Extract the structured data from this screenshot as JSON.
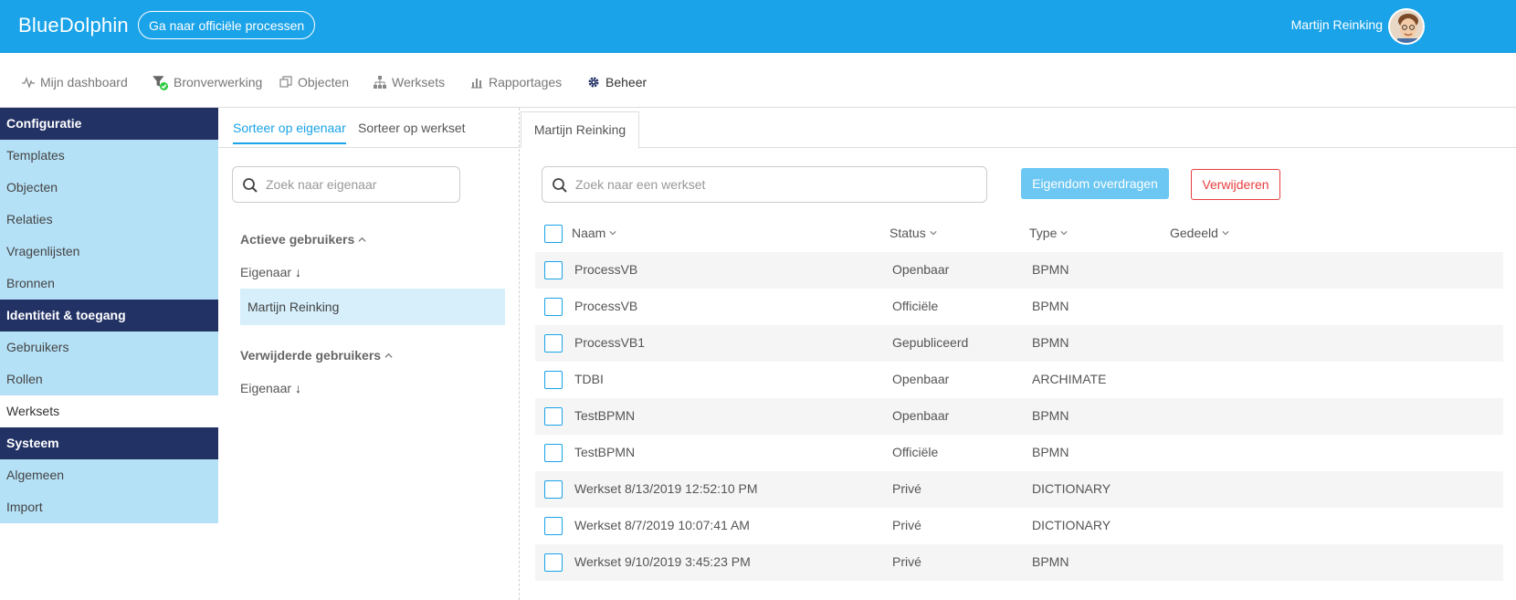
{
  "header": {
    "brand": "BlueDolphin",
    "official_button": "Ga naar officiële processen",
    "user_name": "Martijn Reinking"
  },
  "nav": [
    {
      "label": "Mijn dashboard",
      "icon": "pulse-icon"
    },
    {
      "label": "Bronverwerking",
      "icon": "funnel-check-icon"
    },
    {
      "label": "Objecten",
      "icon": "objects-icon"
    },
    {
      "label": "Werksets",
      "icon": "hierarchy-icon"
    },
    {
      "label": "Rapportages",
      "icon": "bar-chart-icon"
    },
    {
      "label": "Beheer",
      "icon": "gear-icon"
    }
  ],
  "sidebar": {
    "sections": [
      {
        "title": "Configuratie",
        "items": [
          "Templates",
          "Objecten",
          "Relaties",
          "Vragenlijsten",
          "Bronnen"
        ]
      },
      {
        "title": "Identiteit & toegang",
        "items": [
          "Gebruikers",
          "Rollen",
          "Werksets"
        ]
      },
      {
        "title": "Systeem",
        "items": [
          "Algemeen",
          "Import"
        ]
      }
    ],
    "active_item": "Werksets"
  },
  "owner_panel": {
    "tab_owner": "Sorteer op eigenaar",
    "tab_workset": "Sorteer op werkset",
    "search_placeholder": "Zoek naar eigenaar",
    "active_users_title": "Actieve gebruikers",
    "owner_label": "Eigenaar",
    "selected_owner": "Martijn Reinking",
    "deleted_users_title": "Verwijderde gebruikers",
    "deleted_owner_label": "Eigenaar"
  },
  "right_panel": {
    "tab": "Martijn Reinking",
    "search_placeholder": "Zoek naar een werkset",
    "transfer_button": "Eigendom overdragen",
    "delete_button": "Verwijderen",
    "columns": {
      "name": "Naam",
      "status": "Status",
      "type": "Type",
      "shared": "Gedeeld"
    },
    "rows": [
      {
        "name": "ProcessVB",
        "status": "Openbaar",
        "type": "BPMN",
        "shared": ""
      },
      {
        "name": "ProcessVB",
        "status": "Officiële",
        "type": "BPMN",
        "shared": ""
      },
      {
        "name": "ProcessVB1",
        "status": "Gepubliceerd",
        "type": "BPMN",
        "shared": ""
      },
      {
        "name": "TDBI",
        "status": "Openbaar",
        "type": "ARCHIMATE",
        "shared": ""
      },
      {
        "name": "TestBPMN",
        "status": "Openbaar",
        "type": "BPMN",
        "shared": ""
      },
      {
        "name": "TestBPMN",
        "status": "Officiële",
        "type": "BPMN",
        "shared": ""
      },
      {
        "name": "Werkset 8/13/2019 12:52:10 PM",
        "status": "Privé",
        "type": "DICTIONARY",
        "shared": ""
      },
      {
        "name": "Werkset 8/7/2019 10:07:41 AM",
        "status": "Privé",
        "type": "DICTIONARY",
        "shared": ""
      },
      {
        "name": "Werkset 9/10/2019 3:45:23 PM",
        "status": "Privé",
        "type": "BPMN",
        "shared": ""
      }
    ]
  },
  "colors": {
    "header_bg": "#1aa3e8",
    "sidebar_section_bg": "#233265",
    "sidebar_item_bg": "#b5e1f7",
    "transfer_button_bg": "#6cc7f3",
    "delete_button_border": "#e83e3e"
  }
}
